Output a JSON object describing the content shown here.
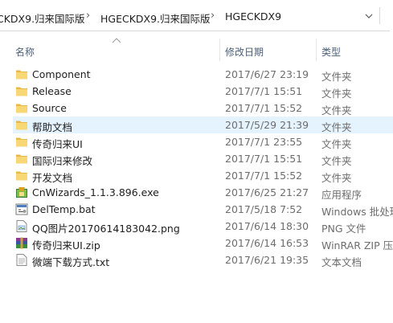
{
  "breadcrumb": {
    "items": [
      "CKDX9.归来国际版",
      "HGECKDX9.归来国际版",
      "HGECKDX9"
    ],
    "separator": "›"
  },
  "columns": {
    "name": "名称",
    "date": "修改日期",
    "type": "类型"
  },
  "files": [
    {
      "name": "Component",
      "date": "2017/6/27 23:19",
      "type": "文件夹",
      "icon": "folder-icon"
    },
    {
      "name": "Release",
      "date": "2017/7/1 15:51",
      "type": "文件夹",
      "icon": "folder-icon"
    },
    {
      "name": "Source",
      "date": "2017/7/1 15:52",
      "type": "文件夹",
      "icon": "folder-icon"
    },
    {
      "name": "帮助文档",
      "date": "2017/5/29 21:39",
      "type": "文件夹",
      "icon": "folder-icon"
    },
    {
      "name": "传奇归来UI",
      "date": "2017/7/1 23:55",
      "type": "文件夹",
      "icon": "folder-icon"
    },
    {
      "name": "国际归来修改",
      "date": "2017/7/1 15:51",
      "type": "文件夹",
      "icon": "folder-icon"
    },
    {
      "name": "开发文档",
      "date": "2017/7/1 15:52",
      "type": "文件夹",
      "icon": "folder-icon"
    },
    {
      "name": "CnWizards_1.1.3.896.exe",
      "date": "2017/6/25 21:27",
      "type": "应用程序",
      "icon": "installer-icon"
    },
    {
      "name": "DelTemp.bat",
      "date": "2017/5/18 7:52",
      "type": "Windows 批处理",
      "icon": "batch-file-icon"
    },
    {
      "name": "QQ图片20170614183042.png",
      "date": "2017/6/14 18:30",
      "type": "PNG 文件",
      "icon": "image-file-icon"
    },
    {
      "name": "传奇归来UI.zip",
      "date": "2017/6/14 16:53",
      "type": "WinRAR ZIP 压缩",
      "icon": "winrar-archive-icon"
    },
    {
      "name": "微端下载方式.txt",
      "date": "2017/6/21 19:35",
      "type": "文本文档",
      "icon": "text-file-icon"
    }
  ],
  "hovered_row": "帮助文档",
  "colors": {
    "hover": "#e5f3ff",
    "folder": "#f8d775",
    "header_text": "#4c607a",
    "meta_text": "#6d6d6d"
  }
}
